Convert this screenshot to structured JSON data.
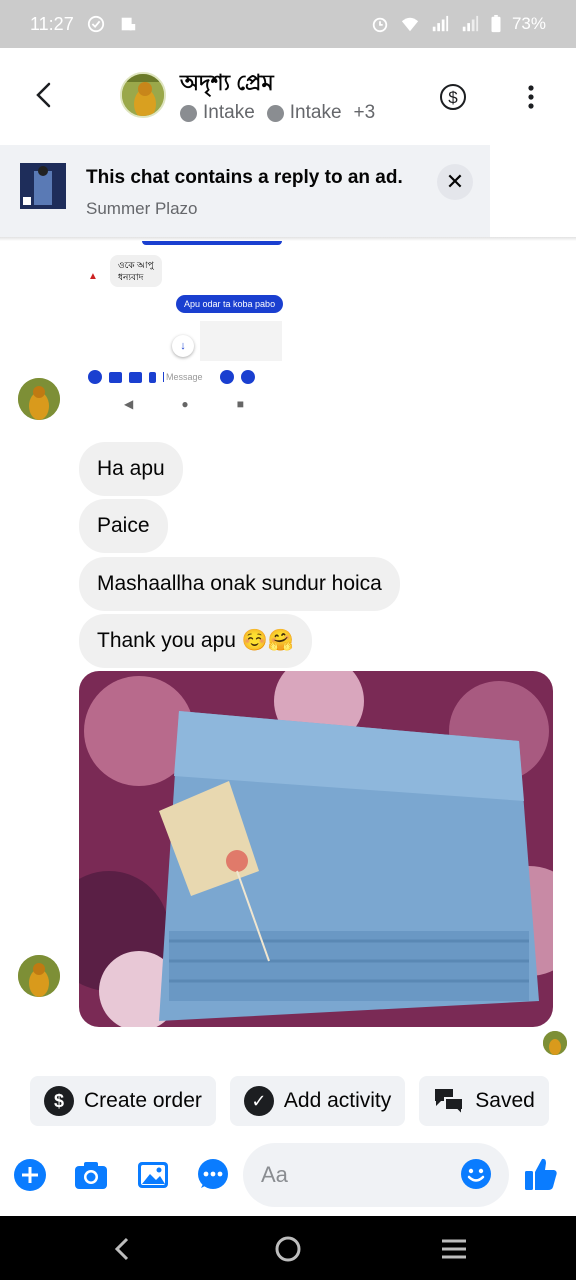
{
  "status_bar": {
    "time": "11:27",
    "battery": "73%"
  },
  "header": {
    "contact_name": "অদৃশ্য প্রেম",
    "tags": [
      "Intake",
      "Intake"
    ],
    "tags_more": "+3"
  },
  "ad_banner": {
    "title": "This chat contains a reply to an ad.",
    "subtitle": "Summer Plazo"
  },
  "embedded_screenshot": {
    "incoming": "ওকে আপু\nধন্যবাদ",
    "outgoing": "Apu odar ta koba pabo",
    "input_placeholder": "Message"
  },
  "messages": [
    {
      "text": "Ha apu"
    },
    {
      "text": "Paice"
    },
    {
      "text": "Mashaallha onak sundur hoica"
    },
    {
      "text": "Thank you apu ☺️🤗"
    }
  ],
  "quick_actions": [
    {
      "label": "Create order",
      "icon": "dollar-circle-icon"
    },
    {
      "label": "Add activity",
      "icon": "check-circle-icon"
    },
    {
      "label": "Saved",
      "icon": "chat-bubbles-icon"
    }
  ],
  "composer": {
    "placeholder": "Aa"
  },
  "colors": {
    "accent": "#0a7cff",
    "bubble": "#f0f0f0",
    "status_bar": "#cbcbcb"
  }
}
